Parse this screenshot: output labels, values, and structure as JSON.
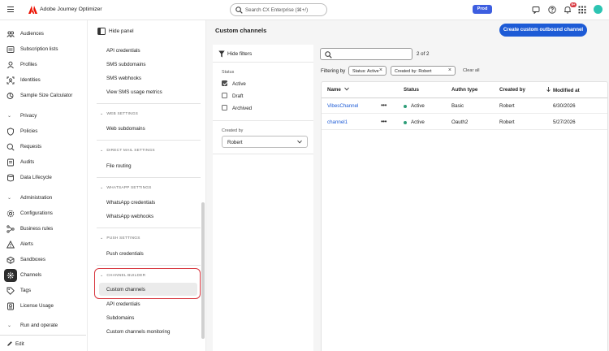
{
  "app": {
    "title": "Adobe Journey Optimizer",
    "environment": "Prod",
    "notification_count": "9+"
  },
  "search": {
    "placeholder": "Search CX Enterprise (⌘+/)"
  },
  "leftnav": {
    "items": [
      {
        "label": "Audiences",
        "icon": "audiences-icon"
      },
      {
        "label": "Subscription lists",
        "icon": "subscription-icon"
      },
      {
        "label": "Profiles",
        "icon": "profiles-icon"
      },
      {
        "label": "Identities",
        "icon": "identities-icon"
      },
      {
        "label": "Sample Size Calculator",
        "icon": "calculator-icon"
      }
    ],
    "privacy": {
      "label": "Privacy",
      "items": [
        {
          "label": "Policies",
          "icon": "policies-icon"
        },
        {
          "label": "Requests",
          "icon": "requests-icon"
        },
        {
          "label": "Audits",
          "icon": "audits-icon"
        },
        {
          "label": "Data Lifecycle",
          "icon": "data-lifecycle-icon"
        }
      ]
    },
    "administration": {
      "label": "Administration",
      "items": [
        {
          "label": "Configurations",
          "icon": "configurations-icon"
        },
        {
          "label": "Business rules",
          "icon": "business-rules-icon"
        },
        {
          "label": "Alerts",
          "icon": "alerts-icon"
        },
        {
          "label": "Sandboxes",
          "icon": "sandboxes-icon"
        },
        {
          "label": "Channels",
          "icon": "channels-icon"
        },
        {
          "label": "Tags",
          "icon": "tags-icon"
        },
        {
          "label": "License Usage",
          "icon": "license-icon"
        }
      ]
    },
    "run": {
      "label": "Run and operate"
    },
    "edit": {
      "label": "Edit"
    }
  },
  "settings_panel": {
    "hide_label": "Hide panel",
    "sms_items": [
      "API credentials",
      "SMS subdomains",
      "SMS webhooks",
      "View SMS usage metrics"
    ],
    "web_heading": "WEB SETTINGS",
    "web_items": [
      "Web subdomains"
    ],
    "mail_heading": "DIRECT MAIL SETTINGS",
    "mail_items": [
      "File routing"
    ],
    "whatsapp_heading": "WHATSAPP SETTINGS",
    "whatsapp_items": [
      "WhatsApp credentials",
      "WhatsApp webhooks"
    ],
    "push_heading": "PUSH SETTINGS",
    "push_items": [
      "Push credentials"
    ],
    "builder_heading": "CHANNEL BUILDER",
    "builder_items": [
      "Custom channels",
      "API credentials",
      "Subdomains",
      "Custom channels monitoring"
    ]
  },
  "main": {
    "title": "Custom channels",
    "create_label": "Create custom outbound channel",
    "hide_filters": "Hide filters",
    "status_label": "Status",
    "status_options": [
      {
        "label": "Active",
        "checked": true
      },
      {
        "label": "Draft",
        "checked": false
      },
      {
        "label": "Archived",
        "checked": false
      }
    ],
    "created_by_label": "Created by",
    "created_by_value": "Robert",
    "count": "2 of 2",
    "filtering_label": "Filtering by",
    "tags": [
      "Status: Active",
      "Created by: Robert"
    ],
    "clear_all": "Clear all",
    "columns": [
      "Name",
      "Status",
      "Authn type",
      "Created by",
      "Modified at"
    ],
    "rows": [
      {
        "name": "VibesChannel",
        "status": "Active",
        "authn": "Basic",
        "created_by": "Robert",
        "modified": "6/30/2026"
      },
      {
        "name": "channel1",
        "status": "Active",
        "authn": "Oauth2",
        "created_by": "Robert",
        "modified": "5/27/2026"
      }
    ]
  }
}
